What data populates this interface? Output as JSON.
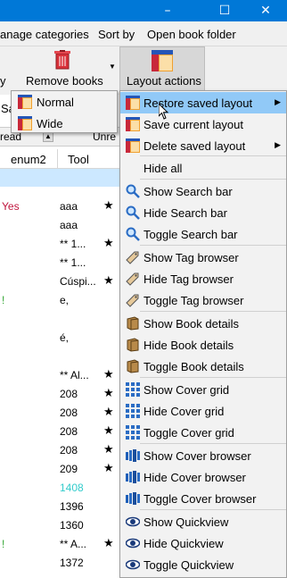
{
  "window": {
    "minimize": "–",
    "maximize": "☐",
    "close": "✕"
  },
  "menubar": {
    "items": [
      "anage categories",
      "Sort by",
      "Open book folder"
    ]
  },
  "toolbar": {
    "left_fragment": "y",
    "remove_books": "Remove books",
    "layout_actions": "Layout actions"
  },
  "background": {
    "tag_browser_fragment": "Sa",
    "tagrow_left": "read",
    "tagrow_right": "Unre",
    "header": {
      "enum2": "enum2",
      "tool": "Tool"
    },
    "rows": [
      {
        "a": "Yes",
        "b": "aaa",
        "star": true
      },
      {
        "a": "",
        "b": "aaa",
        "star": false
      },
      {
        "a": "",
        "b": "** 1...",
        "star": true
      },
      {
        "a": "",
        "b": "** 1...",
        "star": false
      },
      {
        "a": "",
        "b": "Cúspi...",
        "star": true
      },
      {
        "a": "!",
        "b": "e,",
        "star": false
      },
      {
        "a": "",
        "b": "",
        "star": false
      },
      {
        "a": "",
        "b": "é,",
        "star": false
      },
      {
        "a": "",
        "b": "",
        "star": false
      },
      {
        "a": "",
        "b": "** Al...",
        "star": true
      },
      {
        "a": "",
        "b": "208",
        "star": true
      },
      {
        "a": "",
        "b": "208",
        "star": true
      },
      {
        "a": "",
        "b": "208",
        "star": true
      },
      {
        "a": "",
        "b": "208",
        "star": true
      },
      {
        "a": "",
        "b": "209",
        "star": true
      },
      {
        "a": "",
        "b": "1408",
        "star": false
      },
      {
        "a": "",
        "b": "1396",
        "star": false
      },
      {
        "a": "",
        "b": "1360",
        "star": false
      },
      {
        "a": "!",
        "b": "** A...",
        "star": true
      },
      {
        "a": "",
        "b": "1372",
        "star": false
      }
    ]
  },
  "submenu": {
    "items": [
      "Normal",
      "Wide"
    ]
  },
  "dropdown": {
    "items": [
      "Restore saved layout",
      "Save current layout",
      "Delete saved layout",
      "Hide all",
      "Show Search bar",
      "Hide Search bar",
      "Toggle Search bar",
      "Show Tag browser",
      "Hide Tag browser",
      "Toggle Tag browser",
      "Show Book details",
      "Hide Book details",
      "Toggle Book details",
      "Show Cover grid",
      "Hide Cover grid",
      "Toggle Cover grid",
      "Show Cover browser",
      "Hide Cover browser",
      "Toggle Cover browser",
      "Show Quickview",
      "Hide Quickview",
      "Toggle Quickview"
    ],
    "icons": [
      "layout-icon",
      "layout-save-icon",
      "layout-icon",
      "",
      "search-icon",
      "search-icon",
      "search-icon",
      "tag-icon",
      "tag-icon",
      "tag-icon",
      "book-icon",
      "book-icon",
      "book-icon",
      "grid-icon",
      "grid-icon",
      "grid-icon",
      "cover-browser-icon",
      "cover-browser-icon",
      "cover-browser-icon",
      "eye-icon",
      "eye-icon",
      "eye-icon"
    ]
  },
  "colors": {
    "titlebar": "#0078d7",
    "highlight": "#91c9f7",
    "yes_red": "#c0143c",
    "cyan_value": "#33cccc",
    "green_mark": "#2fa52f"
  }
}
